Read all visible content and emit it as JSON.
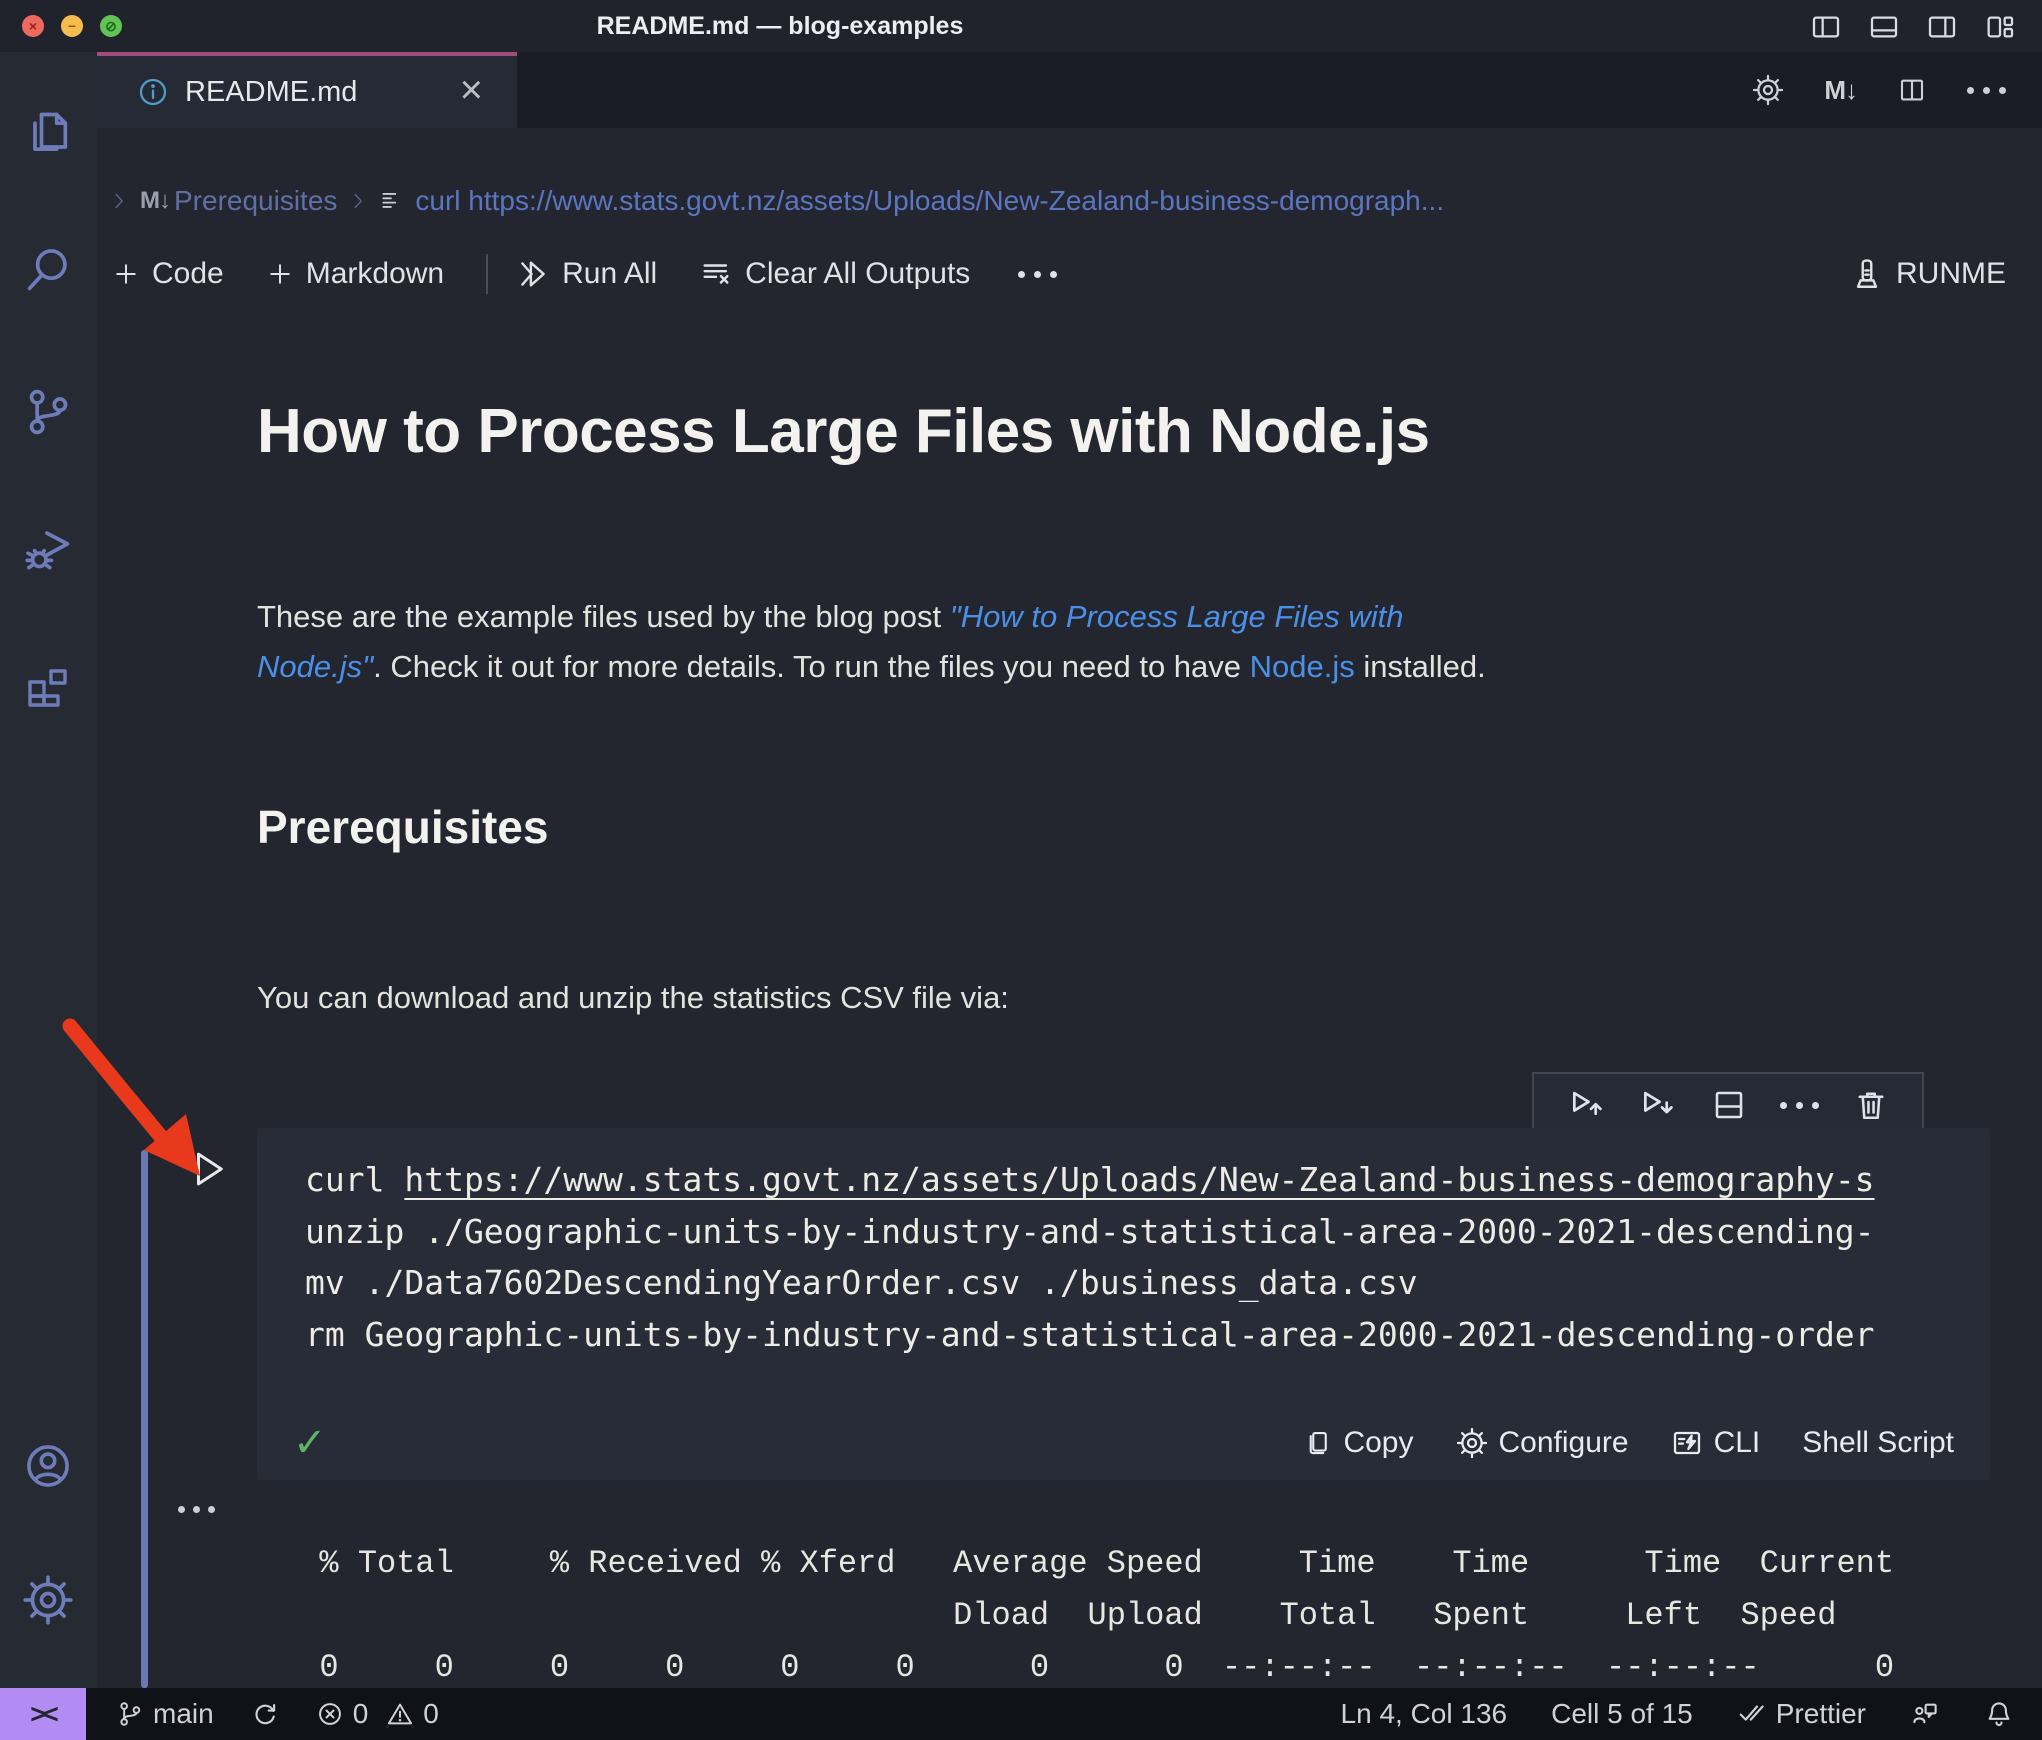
{
  "window": {
    "title": "README.md — blog-examples"
  },
  "tab": {
    "label": "README.md",
    "close": "×"
  },
  "editor_actions": {
    "markdown_preview": "M↓"
  },
  "breadcrumb": {
    "md_icon": "M↓",
    "section": "Prerequisites",
    "cell": "curl https://www.stats.govt.nz/assets/Uploads/New-Zealand-business-demograph..."
  },
  "toolbar": {
    "code": "Code",
    "markdown": "Markdown",
    "run_all": "Run All",
    "clear_all": "Clear All Outputs",
    "runme": "RUNME"
  },
  "markdown": {
    "h1": "How to Process Large Files with Node.js",
    "p1_before": "These are the example files used by the blog post ",
    "p1_link1a": "\"How to Process Large Files with",
    "p1_link1b": "Node.js\"",
    "p1_mid": ". Check it out for more details. To run the files you need to have ",
    "p1_link2": "Node.js",
    "p1_after": " installed.",
    "h2": "Prerequisites",
    "p2": "You can download and unzip the statistics CSV file via:"
  },
  "code": {
    "line1_cmd": "curl ",
    "line1_url": "https://www.stats.govt.nz/assets/Uploads/New-Zealand-business-demography-s",
    "line2": "unzip ./Geographic-units-by-industry-and-statistical-area-2000-2021-descending-",
    "line3": "mv ./Data7602DescendingYearOrder.csv ./business_data.csv",
    "line4": "rm Geographic-units-by-industry-and-statistical-area-2000-2021-descending-order"
  },
  "cell": {
    "check": "✓",
    "copy": "Copy",
    "configure": "Configure",
    "cli": "CLI",
    "language": "Shell Script"
  },
  "output": {
    "header1": "  % Total     % Received % Xferd   Average Speed     Time    Time      Time  Current",
    "header2": "                                   Dload  Upload    Total   Spent     Left  Speed",
    "progress": "  0     0     0     0     0     0      0      0  --:--:--  --:--:--  --:--:--      0"
  },
  "statusbar": {
    "remote": "><",
    "branch": "main",
    "errors": "0",
    "warnings": "0",
    "cursor": "Ln 4, Col 136",
    "cell_position": "Cell 5 of 15",
    "formatter": "Prettier"
  },
  "colors": {
    "tab_accent": "#a04f7c",
    "remote_bg": "#b28cf2",
    "link": "#4b90e8",
    "annotation_arrow": "#e8391d",
    "check": "#5eb266",
    "focus_bar": "#6979b4",
    "activity_icon": "#6e7dba"
  }
}
